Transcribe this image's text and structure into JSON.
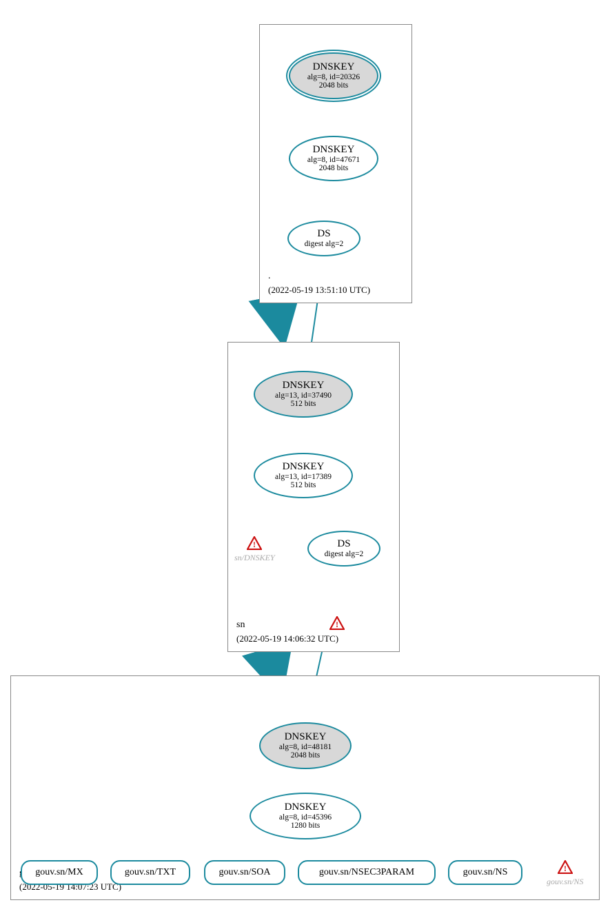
{
  "zones": {
    "root": {
      "title": ".",
      "timestamp": "(2022-05-19 13:51:10 UTC)",
      "nodes": {
        "dnskey1": {
          "label": "DNSKEY",
          "alg": "alg=8, id=20326",
          "bits": "2048 bits"
        },
        "dnskey2": {
          "label": "DNSKEY",
          "alg": "alg=8, id=47671",
          "bits": "2048 bits"
        },
        "ds": {
          "label": "DS",
          "alg": "digest alg=2"
        }
      }
    },
    "sn": {
      "title": "sn",
      "timestamp": "(2022-05-19 14:06:32 UTC)",
      "nodes": {
        "dnskey1": {
          "label": "DNSKEY",
          "alg": "alg=13, id=37490",
          "bits": "512 bits"
        },
        "dnskey2": {
          "label": "DNSKEY",
          "alg": "alg=13, id=17389",
          "bits": "512 bits"
        },
        "ds": {
          "label": "DS",
          "alg": "digest alg=2"
        }
      },
      "warn_dnskey": "sn/DNSKEY"
    },
    "gouv": {
      "title": "gouv.sn",
      "timestamp": "(2022-05-19 14:07:23 UTC)",
      "nodes": {
        "dnskey1": {
          "label": "DNSKEY",
          "alg": "alg=8, id=48181",
          "bits": "2048 bits"
        },
        "dnskey2": {
          "label": "DNSKEY",
          "alg": "alg=8, id=45396",
          "bits": "1280 bits"
        }
      },
      "rrsets": {
        "mx": "gouv.sn/MX",
        "txt": "gouv.sn/TXT",
        "soa": "gouv.sn/SOA",
        "nsec3": "gouv.sn/NSEC3PARAM",
        "ns": "gouv.sn/NS"
      },
      "warn_ns": "gouv.sn/NS"
    }
  }
}
